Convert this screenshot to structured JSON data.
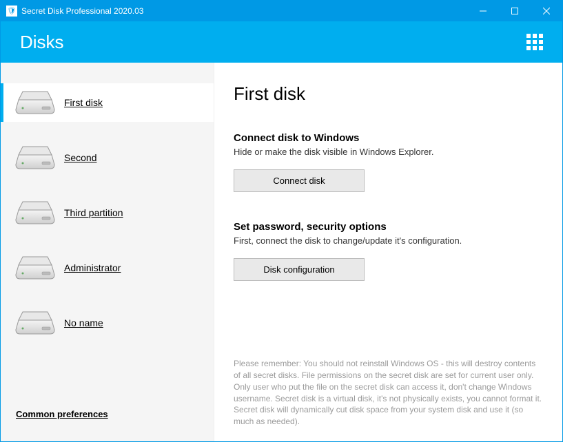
{
  "window": {
    "title": "Secret Disk Professional 2020.03"
  },
  "header": {
    "page_title": "Disks"
  },
  "sidebar": {
    "items": [
      {
        "label": "First disk",
        "active": true
      },
      {
        "label": "Second",
        "active": false
      },
      {
        "label": "Third partition",
        "active": false
      },
      {
        "label": "Administrator",
        "active": false
      },
      {
        "label": "No name",
        "active": false
      }
    ],
    "common_prefs": "Common preferences"
  },
  "main": {
    "heading": "First disk",
    "section1": {
      "title": "Connect disk to Windows",
      "desc": "Hide or make the disk visible in Windows Explorer.",
      "button": "Connect disk"
    },
    "section2": {
      "title": "Set password, security options",
      "desc": "First, connect the disk to change/update it's configuration.",
      "button": "Disk configuration"
    },
    "disclaimer": "Please remember: You should not reinstall Windows OS - this will destroy contents of all secret disks. File permissions on the secret disk are set for current user only. Only user who put the file on the secret disk can access it, don't change Windows username. Secret disk is a virtual disk, it's not physically exists, you cannot format it. Secret disk will dynamically cut disk space from your system disk and use it (so much as needed)."
  }
}
